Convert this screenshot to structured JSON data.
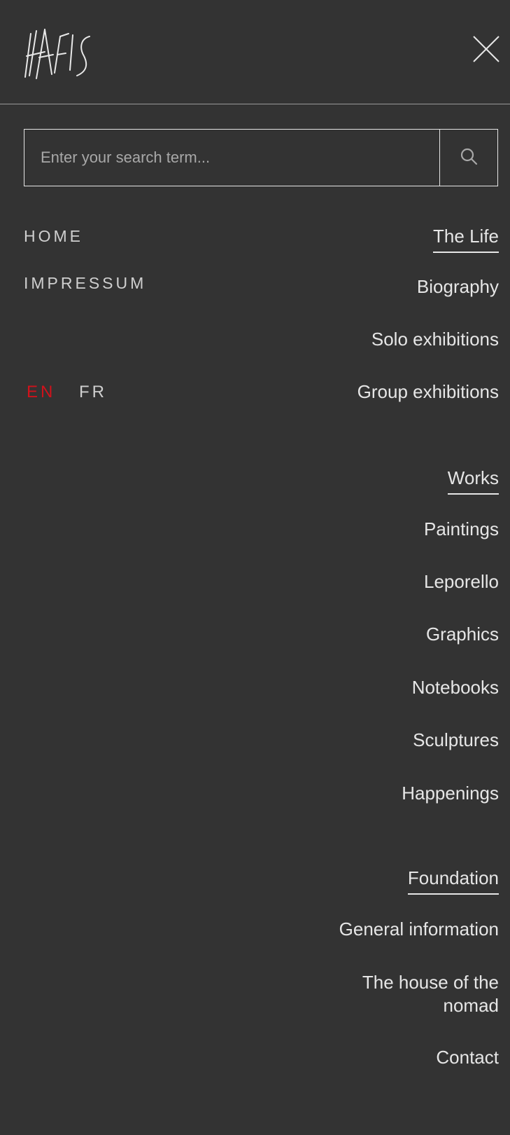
{
  "header": {
    "logo_text": "HAFIS",
    "close_icon": "close-icon"
  },
  "search": {
    "placeholder": "Enter your search term...",
    "value": "",
    "button_icon": "search-icon"
  },
  "left_links": [
    {
      "label": "HOME"
    },
    {
      "label": "IMPRESSUM"
    }
  ],
  "languages": [
    {
      "label": "EN",
      "active": true,
      "color": "#d0121b"
    },
    {
      "label": "FR",
      "active": false,
      "color": "#cfcfcf"
    }
  ],
  "menu": {
    "sections": [
      {
        "heading": "The Life",
        "items": [
          "Biography",
          "Solo exhibitions",
          "Group exhibitions"
        ]
      },
      {
        "heading": "Works",
        "items": [
          "Paintings",
          "Leporello",
          "Graphics",
          "Notebooks",
          "Sculptures",
          "Happenings"
        ]
      },
      {
        "heading": "Foundation",
        "items": [
          "General information",
          "The house of the nomad",
          "Contact"
        ]
      }
    ]
  },
  "colors": {
    "background": "#333333",
    "text": "#e6e6e6",
    "accent_active_language": "#d0121b"
  }
}
